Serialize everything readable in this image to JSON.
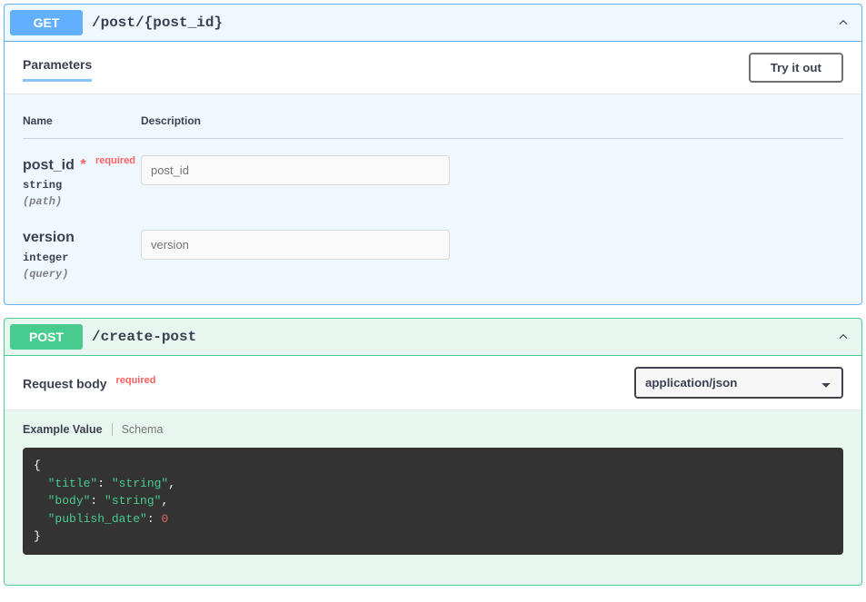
{
  "endpoints": {
    "get_post": {
      "method": "GET",
      "path": "/post/{post_id}",
      "section_label": "Parameters",
      "try_label": "Try it out",
      "columns": {
        "name": "Name",
        "desc": "Description"
      },
      "params": [
        {
          "name": "post_id",
          "required": true,
          "required_text": "required",
          "type": "string",
          "in": "(path)",
          "placeholder": "post_id"
        },
        {
          "name": "version",
          "required": false,
          "type": "integer",
          "in": "(query)",
          "placeholder": "version"
        }
      ]
    },
    "create_post": {
      "method": "POST",
      "path": "/create-post",
      "body_label": "Request body",
      "body_required_text": "required",
      "media_type": "application/json",
      "tabs": {
        "example": "Example Value",
        "schema": "Schema"
      },
      "example_tokens": [
        [
          "punc",
          "{"
        ],
        [
          "nl"
        ],
        [
          "indent"
        ],
        [
          "key",
          "\"title\""
        ],
        [
          "punc",
          ": "
        ],
        [
          "str",
          "\"string\""
        ],
        [
          "punc",
          ","
        ],
        [
          "nl"
        ],
        [
          "indent"
        ],
        [
          "key",
          "\"body\""
        ],
        [
          "punc",
          ": "
        ],
        [
          "str",
          "\"string\""
        ],
        [
          "punc",
          ","
        ],
        [
          "nl"
        ],
        [
          "indent"
        ],
        [
          "key",
          "\"publish_date\""
        ],
        [
          "punc",
          ": "
        ],
        [
          "num",
          "0"
        ],
        [
          "nl"
        ],
        [
          "punc",
          "}"
        ]
      ]
    }
  }
}
